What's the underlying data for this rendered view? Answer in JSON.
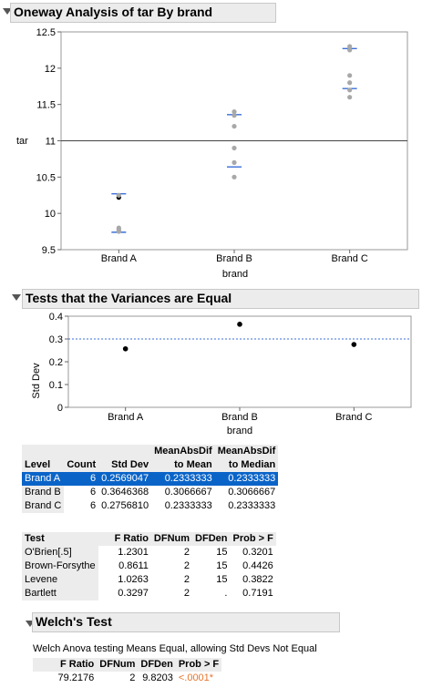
{
  "oneway": {
    "title": "Oneway Analysis of tar By brand",
    "ylabel": "tar",
    "xlabel": "brand"
  },
  "chart_data": [
    {
      "type": "scatter",
      "title": "Oneway Analysis of tar By brand",
      "xlabel": "brand",
      "ylabel": "tar",
      "categories": [
        "Brand A",
        "Brand B",
        "Brand C"
      ],
      "ylim": [
        9.5,
        12.5
      ],
      "yticks": [
        "9.5",
        "10",
        "10.5",
        "11",
        "11.5",
        "12",
        "12.5"
      ],
      "grand_mean": 11,
      "points": [
        {
          "x": "Brand A",
          "values": [
            10.22,
            10.25,
            9.8,
            9.78,
            9.76,
            9.75
          ],
          "mean": 10.22
        },
        {
          "x": "Brand B",
          "values": [
            11.4,
            11.35,
            11.2,
            10.9,
            10.7,
            10.5
          ],
          "mean": 10.97
        },
        {
          "x": "Brand C",
          "values": [
            12.3,
            12.25,
            11.9,
            11.8,
            11.7,
            11.6
          ],
          "mean": 11.78
        }
      ],
      "stddev_bars": [
        {
          "x": "Brand A",
          "upper": 10.27,
          "lower": 9.74
        },
        {
          "x": "Brand B",
          "upper": 11.36,
          "lower": 10.64
        },
        {
          "x": "Brand C",
          "upper": 12.27,
          "lower": 11.72
        }
      ]
    },
    {
      "type": "scatter",
      "title": "Tests that the Variances are Equal",
      "xlabel": "brand",
      "ylabel": "Std Dev",
      "categories": [
        "Brand A",
        "Brand B",
        "Brand C"
      ],
      "values": [
        0.2569047,
        0.3646368,
        0.275681
      ],
      "ylim": [
        0,
        0.4
      ],
      "yticks": [
        "0",
        "0.1",
        "0.2",
        "0.3",
        "0.4"
      ],
      "pooled_line": 0.3
    }
  ],
  "variances": {
    "title": "Tests that the Variances are Equal",
    "ylabel": "Std Dev",
    "xlabel": "brand"
  },
  "level_table": {
    "headers": [
      "Level",
      "Count",
      "Std Dev",
      "MeanAbsDif",
      "to Mean",
      "MeanAbsDif",
      "to Median"
    ],
    "rows": [
      [
        "Brand A",
        "6",
        "0.2569047",
        "0.2333333",
        "0.2333333"
      ],
      [
        "Brand B",
        "6",
        "0.3646368",
        "0.3066667",
        "0.3066667"
      ],
      [
        "Brand C",
        "6",
        "0.2756810",
        "0.2333333",
        "0.2333333"
      ]
    ]
  },
  "test_table": {
    "headers": [
      "Test",
      "F Ratio",
      "DFNum",
      "DFDen",
      "Prob > F"
    ],
    "rows": [
      [
        "O'Brien[.5]",
        "1.2301",
        "2",
        "15",
        "0.3201"
      ],
      [
        "Brown-Forsythe",
        "0.8611",
        "2",
        "15",
        "0.4426"
      ],
      [
        "Levene",
        "1.0263",
        "2",
        "15",
        "0.3822"
      ],
      [
        "Bartlett",
        "0.3297",
        "2",
        ".",
        "0.7191"
      ]
    ]
  },
  "welch": {
    "title": "Welch's Test",
    "description": "Welch Anova testing Means Equal, allowing Std Devs Not Equal",
    "headers": [
      "F Ratio",
      "DFNum",
      "DFDen",
      "Prob > F"
    ],
    "row": [
      "79.2176",
      "2",
      "9.8203",
      "<.0001*"
    ],
    "prob_color": "#e8742a"
  },
  "colors": {
    "mean_line": "#3a6fd8",
    "point": "#a8a8a8",
    "selection": "#0a64c8"
  }
}
